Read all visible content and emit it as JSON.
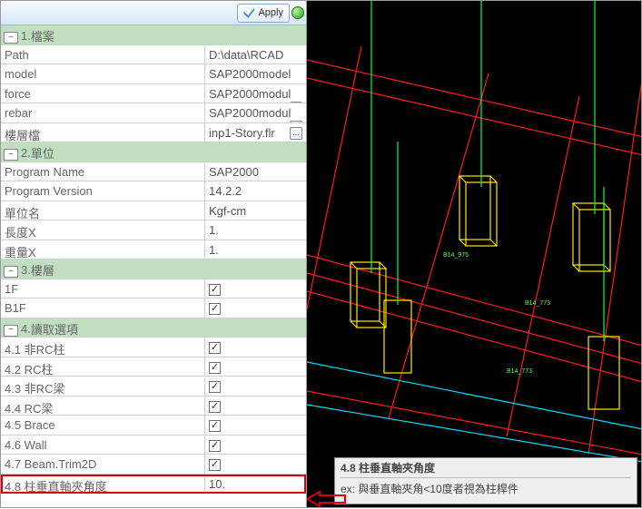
{
  "toolbar": {
    "apply_label": "Apply"
  },
  "sections": {
    "s1": {
      "num": "1.",
      "title": "檔案"
    },
    "s2": {
      "num": "2.",
      "title": "單位"
    },
    "s3": {
      "num": "3.",
      "title": "樓層"
    },
    "s4": {
      "num": "4.",
      "讀取選項": "讀取選項",
      "title": "讀取選項"
    }
  },
  "s1_rows": {
    "path": {
      "label": "Path",
      "value": "D:\\data\\RCAD"
    },
    "model": {
      "label": "model",
      "value": "SAP2000model"
    },
    "force": {
      "label": "force",
      "value": "SAP2000modul"
    },
    "rebar": {
      "label": "rebar",
      "value": "SAP2000modul"
    },
    "story": {
      "label": "樓層檔",
      "value": "inp1-Story.flr"
    }
  },
  "s2_rows": {
    "pname": {
      "label": "Program Name",
      "value": "SAP2000"
    },
    "pver": {
      "label": "Program Version",
      "value": "14.2.2"
    },
    "unit": {
      "label": "單位名",
      "value": "Kgf-cm"
    },
    "lenx": {
      "label": "長度X",
      "value": "1."
    },
    "wgtx": {
      "label": "重量X",
      "value": "1."
    }
  },
  "s3_rows": {
    "f1": {
      "label": "1F",
      "checked": true
    },
    "b1f": {
      "label": "B1F",
      "checked": true
    }
  },
  "s4_rows": {
    "r41": {
      "label": "4.1 非RC柱",
      "checked": true
    },
    "r42": {
      "label": "4.2 RC柱",
      "checked": true
    },
    "r43": {
      "label": "4.3 非RC梁",
      "checked": true
    },
    "r44": {
      "label": "4.4 RC梁",
      "checked": true
    },
    "r45": {
      "label": "4.5 Brace",
      "checked": true
    },
    "r46": {
      "label": "4.6 Wall",
      "checked": true
    },
    "r47": {
      "label": "4.7 Beam.Trim2D",
      "checked": true
    },
    "r48": {
      "label": "4.8 柱垂直軸夾角度",
      "value": "10."
    }
  },
  "info": {
    "title": "4.8 柱垂直軸夾角度",
    "body": "ex: 與垂直軸夾角<10度者視為柱桿件"
  }
}
